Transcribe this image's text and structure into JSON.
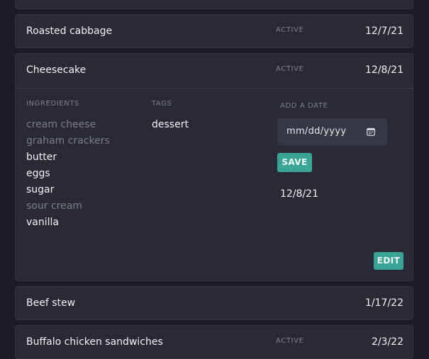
{
  "recipes": [
    {
      "title": "Roasted cabbage",
      "status": "ACTIVE",
      "date": "12/7/21"
    },
    {
      "title": "Cheesecake",
      "status": "ACTIVE",
      "date": "12/8/21"
    },
    {
      "title": "Beef stew",
      "status": "",
      "date": "1/17/22"
    },
    {
      "title": "Buffalo chicken sandwiches",
      "status": "ACTIVE",
      "date": "2/3/22"
    }
  ],
  "expanded": {
    "ingredients_label": "INGREDIENTS",
    "tags_label": "TAGS",
    "add_date_label": "ADD A DATE",
    "ingredients": [
      {
        "name": "cream cheese",
        "active": false
      },
      {
        "name": "graham crackers",
        "active": false
      },
      {
        "name": "butter",
        "active": true
      },
      {
        "name": "eggs",
        "active": true
      },
      {
        "name": "sugar",
        "active": true
      },
      {
        "name": "sour cream",
        "active": false
      },
      {
        "name": "vanilla",
        "active": true
      }
    ],
    "tags": [
      "dessert"
    ],
    "date_input_placeholder": "mm/dd/yyyy",
    "save_label": "SAVE",
    "saved_dates": [
      "12/8/21"
    ],
    "edit_label": "EDIT"
  },
  "colors": {
    "accent": "#3aa597",
    "background": "#1c1d24",
    "card": "#292a35"
  }
}
